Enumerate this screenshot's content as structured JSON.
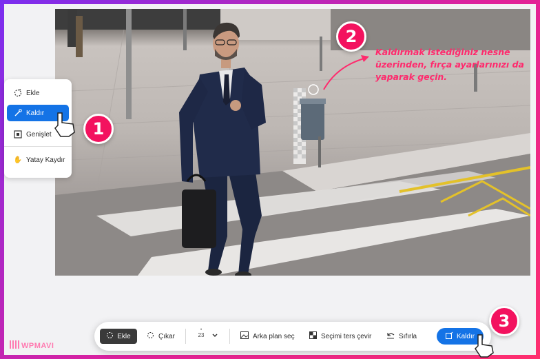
{
  "side_panel": {
    "items": [
      {
        "label": "Ekle",
        "icon": "magic-add-icon"
      },
      {
        "label": "Kaldır",
        "icon": "magic-remove-icon",
        "active": true
      },
      {
        "label": "Genişlet",
        "icon": "expand-icon"
      },
      {
        "label": "Yatay Kaydır",
        "icon": "hand-pan-icon"
      }
    ]
  },
  "badges": {
    "one": "1",
    "two": "2",
    "three": "3"
  },
  "annotation": {
    "text": "Kaldırmak istediğiniz nesne üzerinden, fırça ayarlarınızı da yaparak geçin."
  },
  "toolbar": {
    "ekle_label": "Ekle",
    "cikar_label": "Çıkar",
    "brush_size": "23",
    "select_bg_label": "Arka plan seç",
    "invert_label": "Seçimi ters çevir",
    "reset_label": "Sıfırla",
    "remove_label": "Kaldır"
  },
  "brand": {
    "logo_text": "WPMAVI"
  },
  "colors": {
    "accent": "#1473e6",
    "badge": "#f3125f",
    "annotation": "#ff2a6d"
  }
}
